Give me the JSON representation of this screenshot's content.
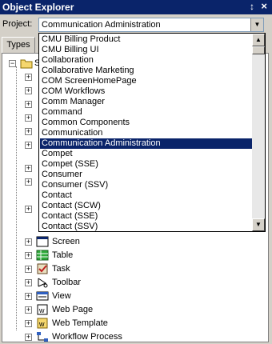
{
  "window": {
    "title": "Object Explorer",
    "pin_glyph": "↕",
    "close_glyph": "×"
  },
  "project": {
    "label": "Project:",
    "value": "Communication Administration"
  },
  "tabs": [
    {
      "label": "Types"
    }
  ],
  "tree": {
    "root_label": "S",
    "items": [
      {
        "label": "Screen",
        "icon": "screen-icon"
      },
      {
        "label": "Table",
        "icon": "table-icon"
      },
      {
        "label": "Task",
        "icon": "task-icon"
      },
      {
        "label": "Toolbar",
        "icon": "toolbar-icon"
      },
      {
        "label": "View",
        "icon": "view-icon"
      },
      {
        "label": "Web Page",
        "icon": "web-page-icon"
      },
      {
        "label": "Web Template",
        "icon": "web-template-icon"
      },
      {
        "label": "Workflow Process",
        "icon": "workflow-process-icon"
      }
    ]
  },
  "dropdown": {
    "items": [
      "CMU Billing Product",
      "CMU Billing UI",
      "Collaboration",
      "Collaborative Marketing",
      "COM ScreenHomePage",
      "COM Workflows",
      "Comm Manager",
      "Command",
      "Common Components",
      "Communication",
      "Communication Administration",
      "Compet",
      "Compet (SSE)",
      "Consumer",
      "Consumer (SSV)",
      "Contact",
      "Contact (SCW)",
      "Contact (SSE)",
      "Contact (SSV)"
    ],
    "selected": "Communication Administration"
  },
  "colors": {
    "titlebar": "#0a246a",
    "selection": "#0a246a",
    "face": "#d4d0c8"
  }
}
